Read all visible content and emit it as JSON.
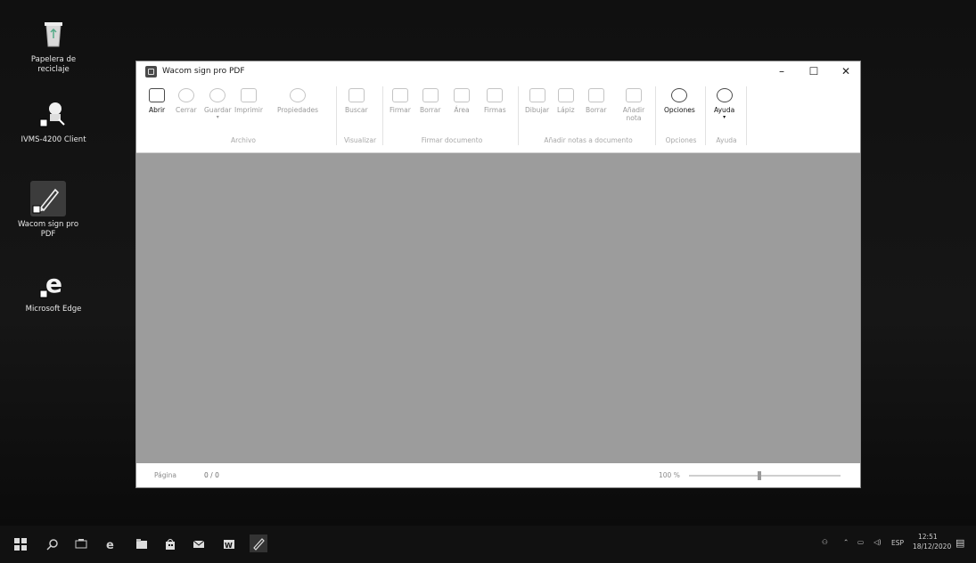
{
  "desktop": {
    "icons": [
      {
        "label": "Papelera de reciclaje",
        "icon": "recycle-bin-icon"
      },
      {
        "label": "IVMS-4200 Client",
        "icon": "ivms-client-icon"
      },
      {
        "label": "Wacom sign pro PDF",
        "icon": "wacom-pen-icon"
      },
      {
        "label": "Microsoft Edge",
        "icon": "edge-icon"
      }
    ]
  },
  "window": {
    "title": "Wacom sign pro PDF",
    "controls": {
      "minimize": "–",
      "maximize": "☐",
      "close": "✕"
    },
    "ribbon": {
      "buttons": [
        {
          "label": "Abrir",
          "icon": "open-folder-icon",
          "active": true
        },
        {
          "label": "Cerrar",
          "icon": "close-doc-icon",
          "active": false
        },
        {
          "label": "Guardar",
          "icon": "save-icon",
          "active": false
        },
        {
          "label": "Imprimir",
          "icon": "print-icon",
          "active": false
        },
        {
          "label": "Propiedades",
          "icon": "properties-icon",
          "active": false
        },
        {
          "label": "Buscar",
          "icon": "search-icon",
          "active": false
        },
        {
          "label": "Firmar",
          "icon": "sign-pen-icon",
          "active": false
        },
        {
          "label": "Borrar",
          "icon": "erase-icon",
          "active": false
        },
        {
          "label": "Área",
          "icon": "area-icon",
          "active": false
        },
        {
          "label": "Firmas",
          "icon": "signatures-icon",
          "active": false
        },
        {
          "label": "Dibujar",
          "icon": "draw-icon",
          "active": false
        },
        {
          "label": "Lápiz",
          "icon": "pencil-icon",
          "active": false
        },
        {
          "label": "Borrar",
          "icon": "eraser-icon",
          "active": false
        },
        {
          "label": "Añadir nota",
          "icon": "add-note-icon",
          "active": false
        },
        {
          "label": "Opciones",
          "icon": "gear-icon",
          "active": true
        },
        {
          "label": "Ayuda",
          "icon": "help-icon",
          "active": true
        }
      ],
      "groups": [
        "Archivo",
        "Visualizar",
        "Firmar documento",
        "Añadir notas a documento",
        "Opciones",
        "Ayuda"
      ]
    },
    "status": {
      "page_label": "Página",
      "page_value": "0 / 0",
      "zoom": "100 %",
      "zoom_level": 0.45
    }
  },
  "taskbar": {
    "items": [
      "start-icon",
      "search-icon",
      "task-view-icon",
      "edge-icon",
      "file-explorer-icon",
      "store-icon",
      "mail-icon",
      "word-icon",
      "wacom-pen-icon"
    ],
    "language": "ESP",
    "time": "12:51",
    "date": "18/12/2020"
  },
  "colors": {
    "desktop_bg": "#111111",
    "doc_area": "#9c9c9c",
    "window_bg": "#ffffff",
    "taskbar_bg": "#111111"
  }
}
